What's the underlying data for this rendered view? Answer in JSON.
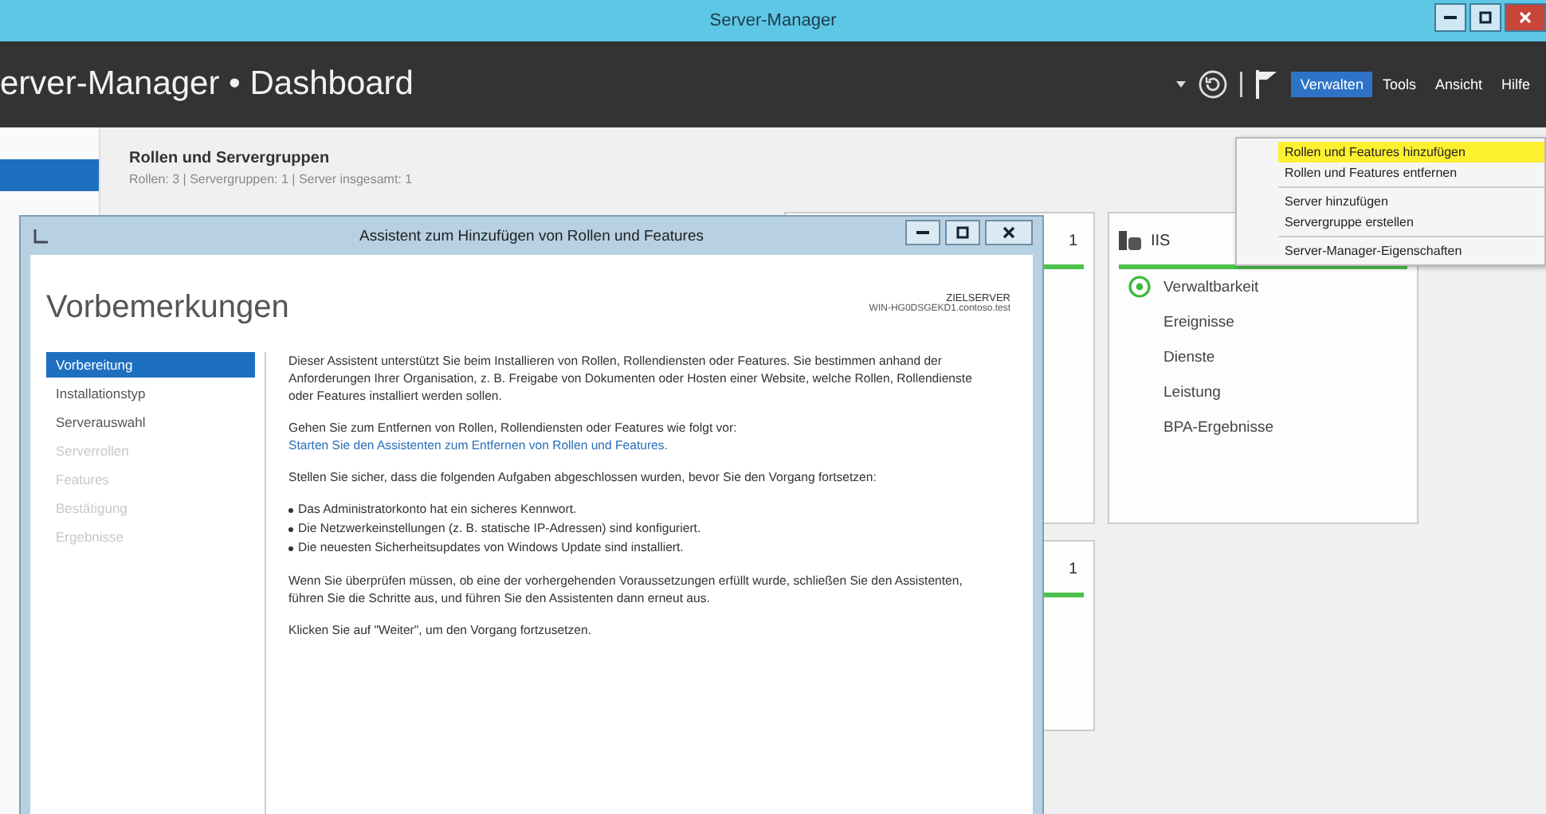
{
  "window": {
    "title": "Server-Manager"
  },
  "header": {
    "title": "erver-Manager • Dashboard",
    "menus": [
      {
        "label": "Verwalten",
        "selected": true
      },
      {
        "label": "Tools",
        "selected": false
      },
      {
        "label": "Ansicht",
        "selected": false
      },
      {
        "label": "Hilfe",
        "selected": false
      }
    ]
  },
  "dropdown": [
    {
      "kind": "item",
      "label": "Rollen und Features hinzufügen",
      "selected": true
    },
    {
      "kind": "item",
      "label": "Rollen und Features entfernen",
      "selected": false
    },
    {
      "kind": "separator"
    },
    {
      "kind": "item",
      "label": "Server hinzufügen",
      "selected": false
    },
    {
      "kind": "item",
      "label": "Servergruppe erstellen",
      "selected": false
    },
    {
      "kind": "separator"
    },
    {
      "kind": "item",
      "label": "Server-Manager-Eigenschaften",
      "selected": false
    }
  ],
  "dashboard": {
    "section_title": "Rollen und Servergruppen",
    "section_subtitle": "Rollen: 3  |  Servergruppen: 1  |  Server insgesamt: 1",
    "tiles": [
      {
        "kind": "partial",
        "count": "1"
      },
      {
        "kind": "full",
        "title": "IIS",
        "items": [
          {
            "label": "Verwaltbarkeit",
            "kind": "status"
          },
          {
            "label": "Ereignisse",
            "kind": "plain"
          },
          {
            "label": "Dienste",
            "kind": "plain"
          },
          {
            "label": "Leistung",
            "kind": "plain"
          },
          {
            "label": "BPA-Ergebnisse",
            "kind": "plain"
          }
        ]
      }
    ],
    "tiles_row2": [
      {
        "kind": "partial",
        "count": "1"
      }
    ]
  },
  "wizard": {
    "title": "Assistent zum Hinzufügen von Rollen und Features",
    "heading": "Vorbemerkungen",
    "target_label": "ZIELSERVER",
    "target_server": "WIN-HG0DSGEKD1.contoso.test",
    "steps": [
      {
        "label": "Vorbereitung",
        "selected": true,
        "disabled": false
      },
      {
        "label": "Installationstyp",
        "selected": false,
        "disabled": false
      },
      {
        "label": "Serverauswahl",
        "selected": false,
        "disabled": false
      },
      {
        "label": "Serverrollen",
        "selected": false,
        "disabled": true
      },
      {
        "label": "Features",
        "selected": false,
        "disabled": true
      },
      {
        "label": "Bestätigung",
        "selected": false,
        "disabled": true
      },
      {
        "label": "Ergebnisse",
        "selected": false,
        "disabled": true
      }
    ],
    "blocks": [
      {
        "kind": "paragraph",
        "text": "Dieser Assistent unterstützt Sie beim Installieren von Rollen, Rollendiensten oder Features. Sie bestimmen anhand der Anforderungen Ihrer Organisation, z. B. Freigabe von Dokumenten oder Hosten einer Website, welche Rollen, Rollendienste oder Features installiert werden sollen."
      },
      {
        "kind": "paragraph",
        "text": "Gehen Sie zum Entfernen von Rollen, Rollendiensten oder Features wie folgt vor:",
        "link": "Starten Sie den Assistenten zum Entfernen von Rollen und Features."
      },
      {
        "kind": "paragraph",
        "text": "Stellen Sie sicher, dass die folgenden Aufgaben abgeschlossen wurden, bevor Sie den Vorgang fortsetzen:"
      },
      {
        "kind": "bullets",
        "items": [
          "Das Administratorkonto hat ein sicheres Kennwort.",
          "Die Netzwerkeinstellungen (z. B. statische IP-Adressen) sind konfiguriert.",
          "Die neuesten Sicherheitsupdates von Windows Update sind installiert."
        ]
      },
      {
        "kind": "paragraph",
        "text": "Wenn Sie überprüfen müssen, ob eine der vorhergehenden Voraussetzungen erfüllt wurde, schließen Sie den Assistenten, führen Sie die Schritte aus, und führen Sie den Assistenten dann erneut aus."
      },
      {
        "kind": "paragraph",
        "text": "Klicken Sie auf \"Weiter\", um den Vorgang fortzusetzen."
      }
    ]
  }
}
